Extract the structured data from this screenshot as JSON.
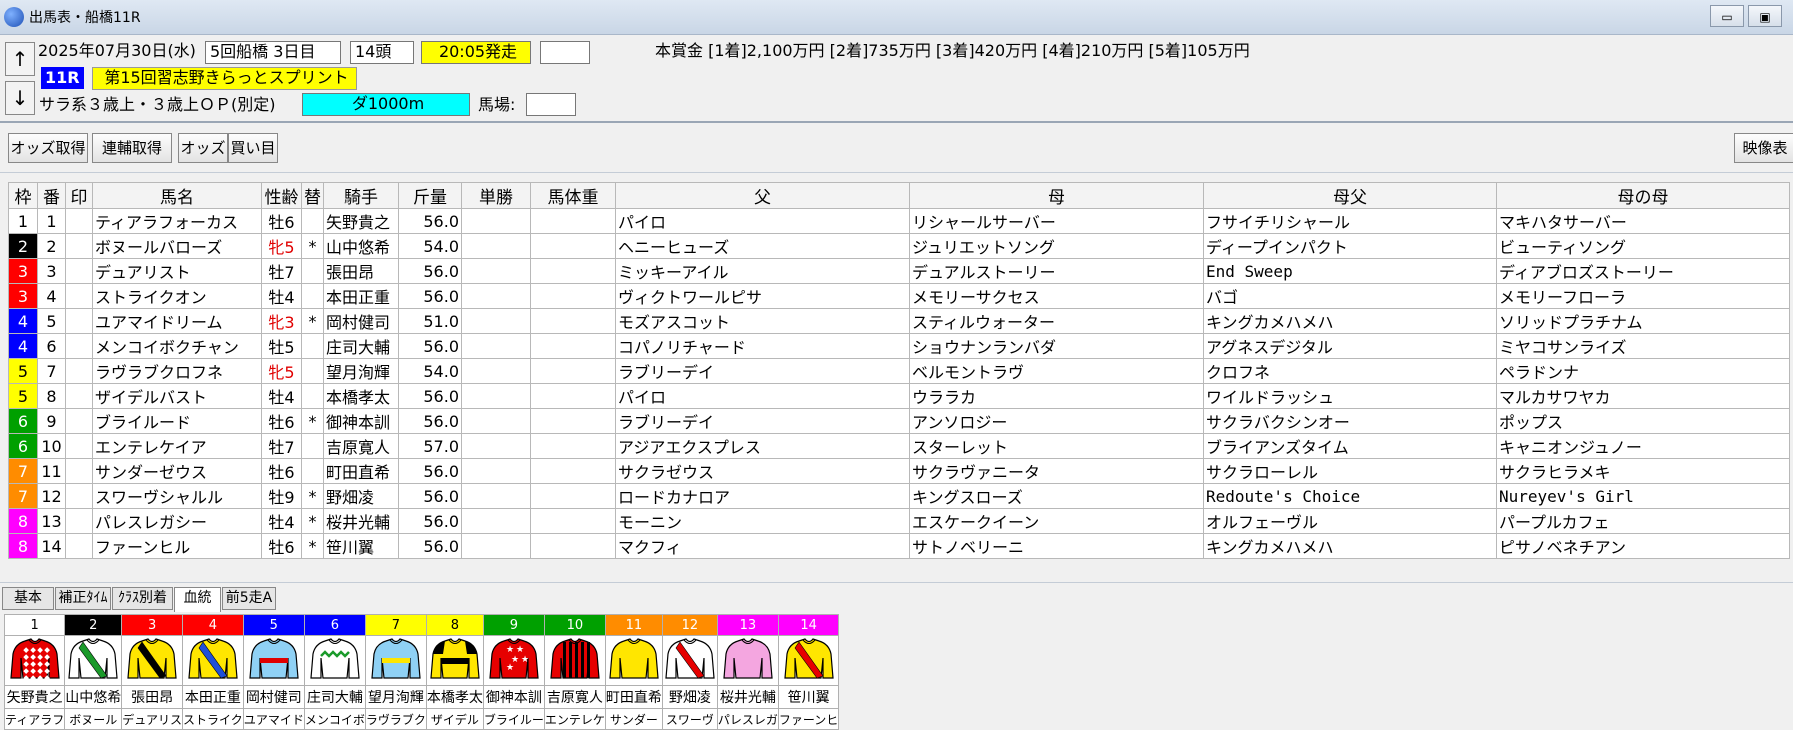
{
  "window": {
    "title": "出馬表・船橋11R"
  },
  "nav": {
    "up": "↑",
    "down": "↓"
  },
  "race": {
    "date": "2025年07月30日(水)",
    "meeting": "5回船橋 3日目",
    "heads": "14頭",
    "post_time": "20:05発走",
    "extra_box": "",
    "race_no": "11R",
    "race_name": "第15回習志野きらっとスプリント",
    "condition": "サラ系３歳上・３歳上ＯＰ(別定)",
    "course": "ダ1000m",
    "track_label": "馬場:",
    "track_value": "",
    "prize": "本賞金 [1着]2,100万円 [2着]735万円 [3着]420万円 [4着]210万円 [5着]105万円"
  },
  "toolbar": {
    "odds_fetch": "オッズ取得",
    "renpuku_fetch": "連輔取得",
    "odds": "オッズ",
    "kaime": "買い目",
    "video": "映像表"
  },
  "table": {
    "headers": [
      "枠",
      "番",
      "印",
      "馬名",
      "性齢",
      "替",
      "騎手",
      "斤量",
      "単勝",
      "馬体重",
      "父",
      "母",
      "母父",
      "母の母"
    ],
    "rows": [
      {
        "waku": "1",
        "ban": "1",
        "mark": "",
        "name": "ティアラフォーカス",
        "sexage": "牡6",
        "alt": "",
        "jockey": "矢野貴之",
        "weight": "56.0",
        "odds": "",
        "bw": "",
        "sire": "パイロ",
        "dam": "リシャールサーバー",
        "damsire": "フサイチリシャール",
        "damdam": "マキハタサーバー"
      },
      {
        "waku": "2",
        "ban": "2",
        "mark": "",
        "name": "ボヌールバローズ",
        "sexage": "牝5",
        "alt": "*",
        "jockey": "山中悠希",
        "weight": "54.0",
        "odds": "",
        "bw": "",
        "sire": "ヘニーヒューズ",
        "dam": "ジュリエットソング",
        "damsire": "ディープインパクト",
        "damdam": "ビューティソング"
      },
      {
        "waku": "3",
        "ban": "3",
        "mark": "",
        "name": "デュアリスト",
        "sexage": "牡7",
        "alt": "",
        "jockey": "張田昂",
        "weight": "56.0",
        "odds": "",
        "bw": "",
        "sire": "ミッキーアイル",
        "dam": "デュアルストーリー",
        "damsire": "End Sweep",
        "damdam": "ディアブロズストーリー"
      },
      {
        "waku": "3",
        "ban": "4",
        "mark": "",
        "name": "ストライクオン",
        "sexage": "牡4",
        "alt": "",
        "jockey": "本田正重",
        "weight": "56.0",
        "odds": "",
        "bw": "",
        "sire": "ヴィクトワールピサ",
        "dam": "メモリーサクセス",
        "damsire": "バゴ",
        "damdam": "メモリーフローラ"
      },
      {
        "waku": "4",
        "ban": "5",
        "mark": "",
        "name": "ユアマイドリーム",
        "sexage": "牝3",
        "alt": "*",
        "jockey": "岡村健司",
        "weight": "51.0",
        "odds": "",
        "bw": "",
        "sire": "モズアスコット",
        "dam": "スティルウォーター",
        "damsire": "キングカメハメハ",
        "damdam": "ソリッドプラチナム"
      },
      {
        "waku": "4",
        "ban": "6",
        "mark": "",
        "name": "メンコイボクチャン",
        "sexage": "牡5",
        "alt": "",
        "jockey": "庄司大輔",
        "weight": "56.0",
        "odds": "",
        "bw": "",
        "sire": "コパノリチャード",
        "dam": "ショウナンランバダ",
        "damsire": "アグネスデジタル",
        "damdam": "ミヤコサンライズ"
      },
      {
        "waku": "5",
        "ban": "7",
        "mark": "",
        "name": "ラヴラブクロフネ",
        "sexage": "牝5",
        "alt": "",
        "jockey": "望月洵輝",
        "weight": "54.0",
        "odds": "",
        "bw": "",
        "sire": "ラブリーデイ",
        "dam": "ベルモントラヴ",
        "damsire": "クロフネ",
        "damdam": "ペラドンナ"
      },
      {
        "waku": "5",
        "ban": "8",
        "mark": "",
        "name": "ザイデルバスト",
        "sexage": "牡4",
        "alt": "",
        "jockey": "本橋孝太",
        "weight": "56.0",
        "odds": "",
        "bw": "",
        "sire": "パイロ",
        "dam": "ウララカ",
        "damsire": "ワイルドラッシュ",
        "damdam": "マルカサワヤカ"
      },
      {
        "waku": "6",
        "ban": "9",
        "mark": "",
        "name": "ブライルード",
        "sexage": "牡6",
        "alt": "*",
        "jockey": "御神本訓",
        "weight": "56.0",
        "odds": "",
        "bw": "",
        "sire": "ラブリーデイ",
        "dam": "アンソロジー",
        "damsire": "サクラバクシンオー",
        "damdam": "ポップス"
      },
      {
        "waku": "6",
        "ban": "10",
        "mark": "",
        "name": "エンテレケイア",
        "sexage": "牡7",
        "alt": "",
        "jockey": "吉原寛人",
        "weight": "57.0",
        "odds": "",
        "bw": "",
        "sire": "アジアエクスプレス",
        "dam": "スターレット",
        "damsire": "ブライアンズタイム",
        "damdam": "キャニオンジュノー"
      },
      {
        "waku": "7",
        "ban": "11",
        "mark": "",
        "name": "サンダーゼウス",
        "sexage": "牡6",
        "alt": "",
        "jockey": "町田直希",
        "weight": "56.0",
        "odds": "",
        "bw": "",
        "sire": "サクラゼウス",
        "dam": "サクラヴァニータ",
        "damsire": "サクラローレル",
        "damdam": "サクラヒラメキ"
      },
      {
        "waku": "7",
        "ban": "12",
        "mark": "",
        "name": "スワーヴシャルル",
        "sexage": "牡9",
        "alt": "*",
        "jockey": "野畑凌",
        "weight": "56.0",
        "odds": "",
        "bw": "",
        "sire": "ロードカナロア",
        "dam": "キングスローズ",
        "damsire": "Redoute's Choice",
        "damdam": "Nureyev's Girl"
      },
      {
        "waku": "8",
        "ban": "13",
        "mark": "",
        "name": "パレスレガシー",
        "sexage": "牡4",
        "alt": "*",
        "jockey": "桜井光輔",
        "weight": "56.0",
        "odds": "",
        "bw": "",
        "sire": "モーニン",
        "dam": "エスケークイーン",
        "damsire": "オルフェーヴル",
        "damdam": "パープルカフェ"
      },
      {
        "waku": "8",
        "ban": "14",
        "mark": "",
        "name": "ファーンヒル",
        "sexage": "牡6",
        "alt": "*",
        "jockey": "笹川翼",
        "weight": "56.0",
        "odds": "",
        "bw": "",
        "sire": "マクフィ",
        "dam": "サトノベリーニ",
        "damsire": "キングカメハメハ",
        "damdam": "ピサノベネチアン"
      }
    ]
  },
  "tabs": [
    "基本",
    "補正ﾀｲﾑ",
    "ｸﾗｽ別着",
    "血統",
    "前5走A"
  ],
  "active_tab": "血統",
  "silks": [
    {
      "num": "1",
      "jockey": "矢野貴之",
      "horse": "ティアラフ",
      "bg": "#ffffff",
      "fg": "#000000",
      "body": "#e60000",
      "accent": "#ffffff",
      "pattern": "check"
    },
    {
      "num": "2",
      "jockey": "山中悠希",
      "horse": "ボヌール",
      "bg": "#000000",
      "fg": "#ffffff",
      "body": "#ffffff",
      "accent": "#1a9a2a",
      "pattern": "sash"
    },
    {
      "num": "3",
      "jockey": "張田昂",
      "horse": "デュアリス",
      "bg": "#ff0000",
      "fg": "#ffffff",
      "body": "#ffe600",
      "accent": "#000000",
      "pattern": "sash"
    },
    {
      "num": "4",
      "jockey": "本田正重",
      "horse": "ストライク",
      "bg": "#ff0000",
      "fg": "#ffffff",
      "body": "#ffe600",
      "accent": "#1f4fd8",
      "pattern": "sash"
    },
    {
      "num": "5",
      "jockey": "岡村健司",
      "horse": "ユアマイド",
      "bg": "#0000ff",
      "fg": "#ffffff",
      "body": "#8fd1f5",
      "accent": "#e00000",
      "pattern": "band"
    },
    {
      "num": "6",
      "jockey": "庄司大輔",
      "horse": "メンコイボ",
      "bg": "#0000ff",
      "fg": "#ffffff",
      "body": "#ffffff",
      "accent": "#1a9a2a",
      "pattern": "zigzag"
    },
    {
      "num": "7",
      "jockey": "望月洵輝",
      "horse": "ラヴラブク",
      "bg": "#ffff00",
      "fg": "#000000",
      "body": "#8fd1f5",
      "accent": "#ffe600",
      "pattern": "band"
    },
    {
      "num": "8",
      "jockey": "本橋孝太",
      "horse": "ザイデル",
      "bg": "#ffff00",
      "fg": "#000000",
      "body": "#ffe600",
      "accent": "#000000",
      "pattern": "shoulder"
    },
    {
      "num": "9",
      "jockey": "御神本訓",
      "horse": "ブライルー",
      "bg": "#00a000",
      "fg": "#ffffff",
      "body": "#e60000",
      "accent": "#ffffff",
      "pattern": "stars"
    },
    {
      "num": "10",
      "jockey": "吉原寛人",
      "horse": "エンテレケ",
      "bg": "#00a000",
      "fg": "#ffffff",
      "body": "#e60000",
      "accent": "#000000",
      "pattern": "stripes"
    },
    {
      "num": "11",
      "jockey": "町田直希",
      "horse": "サンダー",
      "bg": "#ff8c00",
      "fg": "#ffffff",
      "body": "#ffe600",
      "accent": "#ffe600",
      "pattern": "plain"
    },
    {
      "num": "12",
      "jockey": "野畑凌",
      "horse": "スワーヴ",
      "bg": "#ff8c00",
      "fg": "#ffffff",
      "body": "#ffffff",
      "accent": "#e60000",
      "pattern": "sash"
    },
    {
      "num": "13",
      "jockey": "桜井光輔",
      "horse": "パレスレガ",
      "bg": "#ff00ff",
      "fg": "#ffffff",
      "body": "#f4a6e0",
      "accent": "#f4a6e0",
      "pattern": "plain"
    },
    {
      "num": "14",
      "jockey": "笹川翼",
      "horse": "ファーンヒ",
      "bg": "#ff00ff",
      "fg": "#ffffff",
      "body": "#ffe600",
      "accent": "#e60000",
      "pattern": "sash"
    }
  ],
  "waku_colors": {
    "1": {
      "bg": "#ffffff",
      "fg": "#000000"
    },
    "2": {
      "bg": "#000000",
      "fg": "#ffffff"
    },
    "3": {
      "bg": "#ff0000",
      "fg": "#ffffff"
    },
    "4": {
      "bg": "#0000ff",
      "fg": "#ffffff"
    },
    "5": {
      "bg": "#ffff00",
      "fg": "#000000"
    },
    "6": {
      "bg": "#00a000",
      "fg": "#ffffff"
    },
    "7": {
      "bg": "#ff8c00",
      "fg": "#ffffff"
    },
    "8": {
      "bg": "#ff00ff",
      "fg": "#ffffff"
    }
  }
}
